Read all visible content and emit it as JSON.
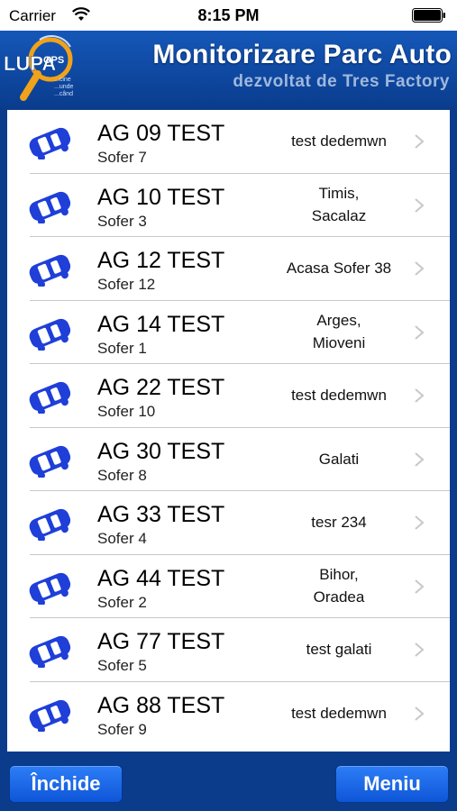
{
  "status_bar": {
    "carrier": "Carrier",
    "time": "8:15 PM"
  },
  "header": {
    "title": "Monitorizare Parc Auto",
    "subtitle": "dezvoltat de Tres Factory",
    "logo_text": "LUPA",
    "logo_badge": "GPS",
    "logo_tagline": [
      "...cine",
      "...unde",
      "...când"
    ]
  },
  "vehicles": [
    {
      "plate": "AG 09 TEST",
      "driver": "Sofer 7",
      "location": "test dedemwn"
    },
    {
      "plate": "AG 10 TEST",
      "driver": "Sofer 3",
      "location": "Timis,\nSacalaz"
    },
    {
      "plate": "AG 12 TEST",
      "driver": "Sofer 12",
      "location": "Acasa Sofer 38"
    },
    {
      "plate": "AG 14 TEST",
      "driver": "Sofer 1",
      "location": "Arges,\nMioveni"
    },
    {
      "plate": "AG 22 TEST",
      "driver": "Sofer 10",
      "location": "test dedemwn"
    },
    {
      "plate": "AG 30 TEST",
      "driver": "Sofer 8",
      "location": "Galati"
    },
    {
      "plate": "AG 33 TEST",
      "driver": "Sofer 4",
      "location": "tesr 234"
    },
    {
      "plate": "AG 44 TEST",
      "driver": "Sofer 2",
      "location": "Bihor,\nOradea"
    },
    {
      "plate": "AG 77 TEST",
      "driver": "Sofer 5",
      "location": "test galati"
    },
    {
      "plate": "AG 88 TEST",
      "driver": "Sofer 9",
      "location": "test dedemwn"
    }
  ],
  "footer": {
    "close_label": "Închide",
    "menu_label": "Meniu"
  },
  "colors": {
    "bar_blue": "#0b3c8c",
    "button_blue": "#1a68e8",
    "car_blue": "#1f3fd8"
  }
}
